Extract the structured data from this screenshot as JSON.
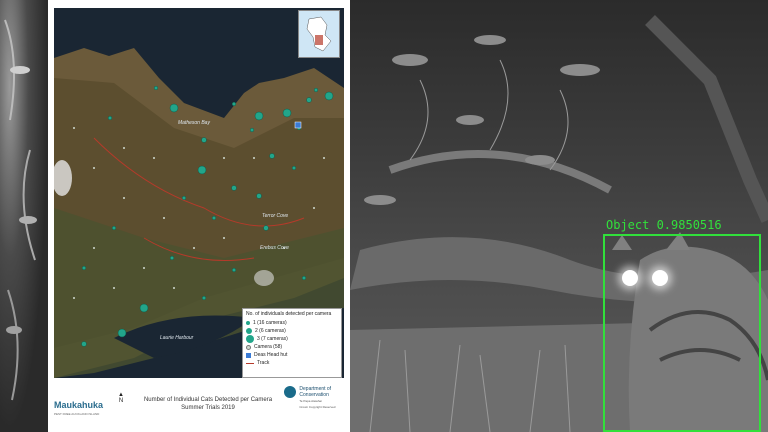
{
  "map": {
    "places": {
      "matheson_bay": "Matheson Bay",
      "terror_cove": "Terror Cove",
      "erebus_cove": "Erebus Cove",
      "laurie_harbour": "Laurie Harbour"
    },
    "legend": {
      "title": "No. of individuals detected per camera",
      "items": [
        {
          "label": "1 (16 cameras)"
        },
        {
          "label": "2 (6 cameras)"
        },
        {
          "label": "3 (7 cameras)"
        }
      ],
      "camera": "Camera (58)",
      "hut": "Deas Head hut",
      "track": "Track"
    },
    "footer": {
      "logo": "Maukahuka",
      "logo_sub": "PEST FREE AUCKLAND ISLAND",
      "north": "N",
      "title_line1": "Number of Individual Cats Detected per Camera",
      "title_line2": "Summer Trials 2019",
      "doc_name": "Department of Conservation",
      "doc_maori": "Te Papa Atawhai",
      "doc_credit": "Crown Copyright Reserved"
    }
  },
  "detection": {
    "label": "Object 0.9850516"
  },
  "colors": {
    "detection": "#31e03b",
    "marker": "#22a58a"
  }
}
